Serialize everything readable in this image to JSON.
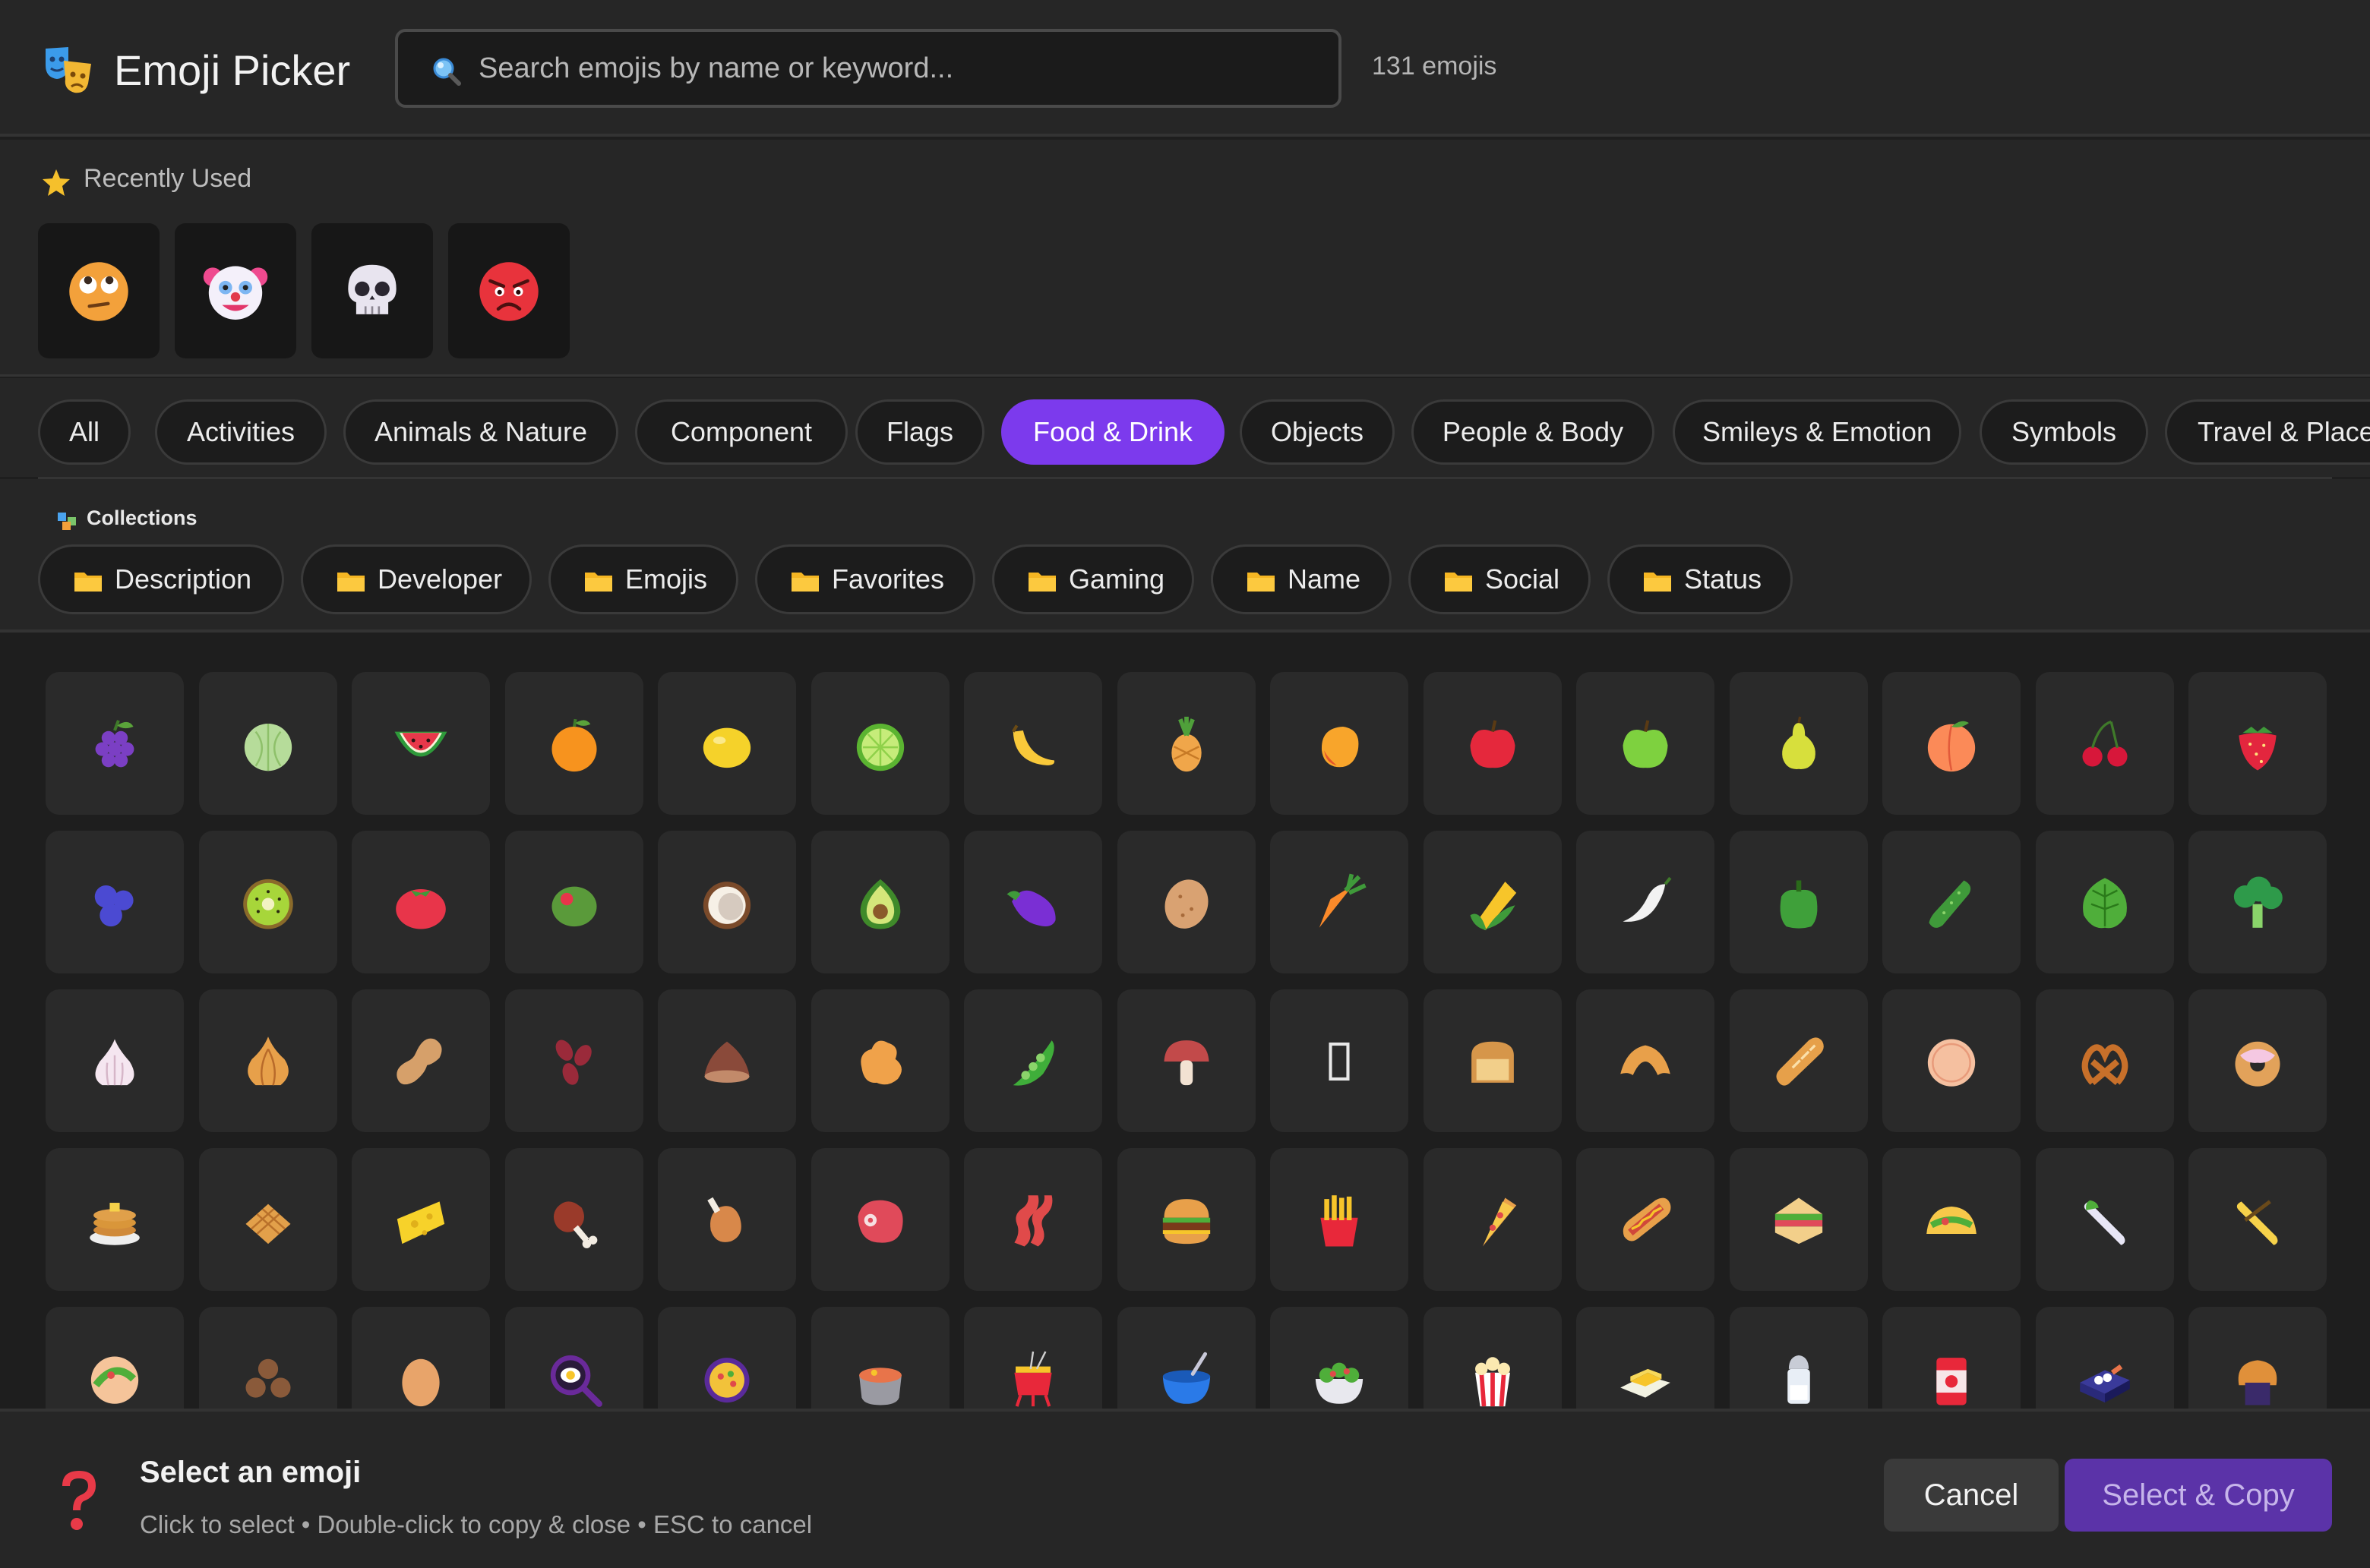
{
  "header": {
    "title": "Emoji Picker",
    "search_placeholder": "Search emojis by name or keyword...",
    "search_value": "",
    "count": "131 emojis"
  },
  "recent": {
    "label": "Recently Used",
    "items": [
      "face-with-rolling-eyes-emoji",
      "clown-face-emoji",
      "skull-emoji",
      "angry-face-emoji"
    ]
  },
  "tabs": [
    "All",
    "Activities",
    "Animals & Nature",
    "Component",
    "Flags",
    "Food & Drink",
    "Objects",
    "People & Body",
    "Smileys & Emotion",
    "Symbols",
    "Travel & Places"
  ],
  "active_tab": "Food & Drink",
  "collections": {
    "label": "Collections",
    "items": [
      "Description",
      "Developer",
      "Emojis",
      "Favorites",
      "Gaming",
      "Name",
      "Social",
      "Status"
    ]
  },
  "grid": {
    "emojis": [
      "grapes",
      "melon",
      "watermelon",
      "tangerine",
      "lemon",
      "lime",
      "banana",
      "pineapple",
      "mango",
      "red-apple",
      "green-apple",
      "pear",
      "peach",
      "cherries",
      "strawberry",
      "blueberries",
      "kiwi",
      "tomato",
      "olive",
      "coconut",
      "avocado",
      "eggplant",
      "potato",
      "carrot",
      "corn",
      "hot-pepper",
      "bell-pepper",
      "cucumber",
      "leafy-green",
      "broccoli",
      "garlic",
      "onion",
      "peanuts",
      "beans",
      "chestnut",
      "ginger",
      "pea-pod",
      "mushroom",
      "missing-glyph",
      "bread",
      "croissant",
      "baguette",
      "flatbread",
      "pretzel",
      "bagel",
      "pancakes",
      "waffle",
      "cheese",
      "meat-on-bone",
      "poultry-leg",
      "cut-of-meat",
      "bacon",
      "hamburger",
      "french-fries",
      "pizza",
      "hot-dog",
      "sandwich",
      "taco",
      "burrito",
      "tamale",
      "stuffed-flatbread",
      "falafel",
      "egg",
      "cooking",
      "shallow-pan-of-food",
      "pot-of-food",
      "fondue",
      "bowl-with-spoon",
      "green-salad",
      "popcorn",
      "butter",
      "salt",
      "canned-food",
      "bento-box",
      "rice-cracker"
    ]
  },
  "footer": {
    "title": "Select an emoji",
    "hint": "Click to select • Double-click to copy & close • ESC to cancel",
    "cancel": "Cancel",
    "select": "Select & Copy"
  },
  "colors": {
    "accent": "#7c3aed",
    "select_button": "#5b33a8",
    "background": "#1e1e1e",
    "panel": "#262626"
  }
}
